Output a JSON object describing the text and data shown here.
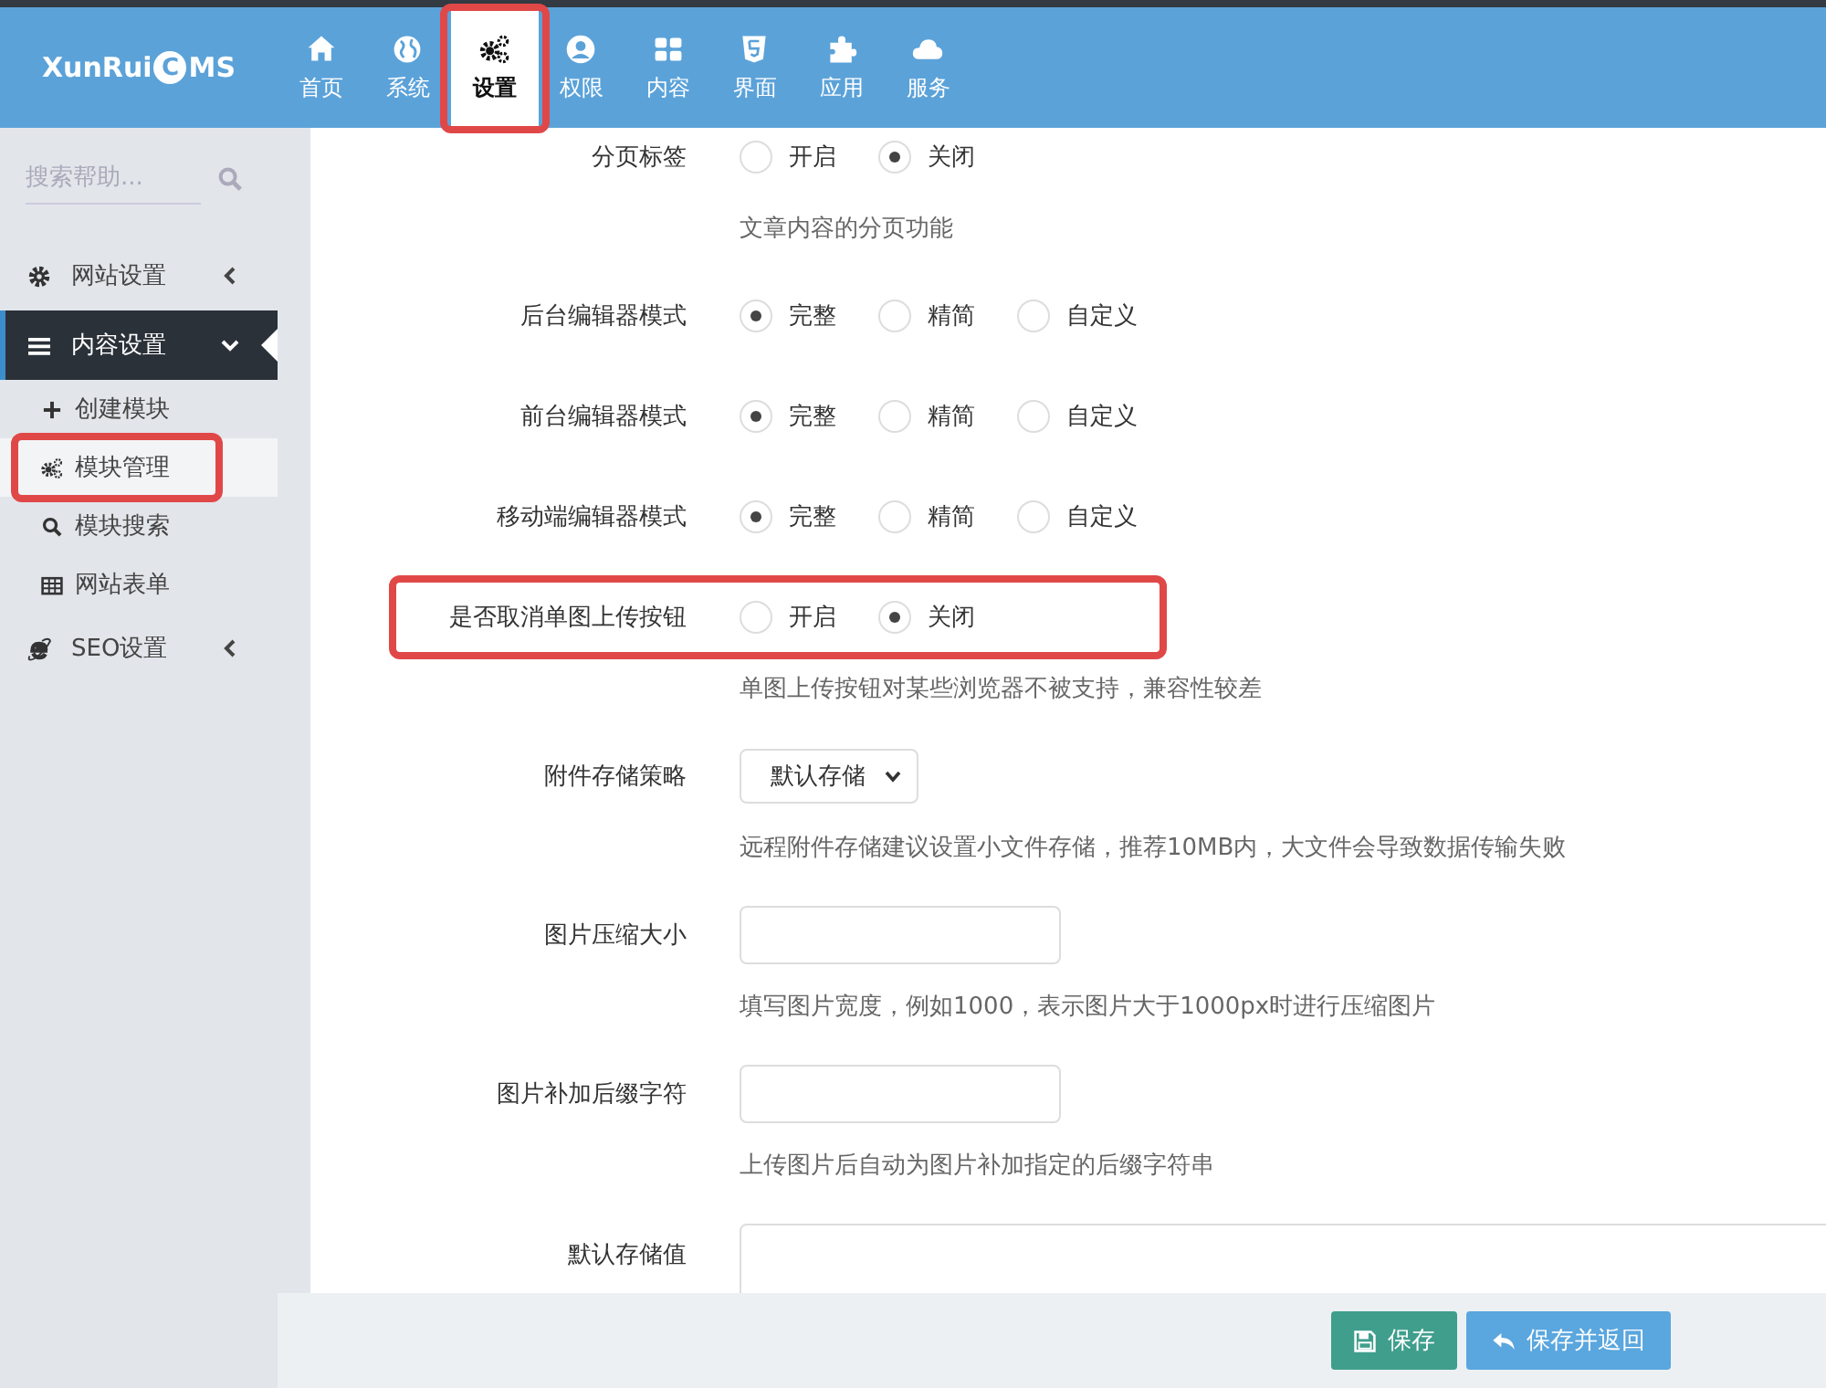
{
  "logo": {
    "prefix": "XunRui",
    "mark": "C",
    "suffix": "MS"
  },
  "nav": [
    {
      "label": "首页",
      "selected": false,
      "highlighted": false
    },
    {
      "label": "系统",
      "selected": false,
      "highlighted": false
    },
    {
      "label": "设置",
      "selected": true,
      "highlighted": true
    },
    {
      "label": "权限",
      "selected": false,
      "highlighted": false
    },
    {
      "label": "内容",
      "selected": false,
      "highlighted": false
    },
    {
      "label": "界面",
      "selected": false,
      "highlighted": false
    },
    {
      "label": "应用",
      "selected": false,
      "highlighted": false
    },
    {
      "label": "服务",
      "selected": false,
      "highlighted": false
    }
  ],
  "sidebar": {
    "search": {
      "placeholder": "搜索帮助..."
    },
    "items": [
      {
        "label": "网站设置",
        "expanded": false,
        "selected": false
      },
      {
        "label": "内容设置",
        "expanded": true,
        "selected": true,
        "children": [
          {
            "label": "创建模块",
            "selected": false,
            "highlighted": false
          },
          {
            "label": "模块管理",
            "selected": true,
            "highlighted": true
          },
          {
            "label": "模块搜索",
            "selected": false,
            "highlighted": false
          },
          {
            "label": "网站表单",
            "selected": false,
            "highlighted": false
          }
        ]
      },
      {
        "label": "SEO设置",
        "expanded": false,
        "selected": false
      }
    ]
  },
  "form": [
    {
      "kind": "radio",
      "label": "分页标签",
      "highlighted": false,
      "options": [
        {
          "label": "开启",
          "selected": false
        },
        {
          "label": "关闭",
          "selected": true
        }
      ],
      "help": "文章内容的分页功能"
    },
    {
      "kind": "radio",
      "label": "后台编辑器模式",
      "highlighted": false,
      "options": [
        {
          "label": "完整",
          "selected": true
        },
        {
          "label": "精简",
          "selected": false
        },
        {
          "label": "自定义",
          "selected": false
        }
      ]
    },
    {
      "kind": "radio",
      "label": "前台编辑器模式",
      "highlighted": false,
      "options": [
        {
          "label": "完整",
          "selected": true
        },
        {
          "label": "精简",
          "selected": false
        },
        {
          "label": "自定义",
          "selected": false
        }
      ]
    },
    {
      "kind": "radio",
      "label": "移动端编辑器模式",
      "highlighted": false,
      "options": [
        {
          "label": "完整",
          "selected": true
        },
        {
          "label": "精简",
          "selected": false
        },
        {
          "label": "自定义",
          "selected": false
        }
      ]
    },
    {
      "kind": "radio",
      "label": "是否取消单图上传按钮",
      "highlighted": true,
      "options": [
        {
          "label": "开启",
          "selected": false
        },
        {
          "label": "关闭",
          "selected": true
        }
      ],
      "help": "单图上传按钮对某些浏览器不被支持，兼容性较差"
    },
    {
      "kind": "select",
      "label": "附件存储策略",
      "highlighted": false,
      "value": "默认存储",
      "help": "远程附件存储建议设置小文件存储，推荐10MB内，大文件会导致数据传输失败"
    },
    {
      "kind": "input",
      "label": "图片压缩大小",
      "highlighted": false,
      "help": "填写图片宽度，例如1000，表示图片大于1000px时进行压缩图片"
    },
    {
      "kind": "input",
      "label": "图片补加后缀字符",
      "highlighted": false,
      "help": "上传图片后自动为图片补加指定的后缀字符串"
    },
    {
      "kind": "textarea",
      "label": "默认存储值",
      "highlighted": false
    }
  ],
  "buttons": [
    {
      "label": "保存",
      "kind": "save"
    },
    {
      "label": "保存并返回",
      "kind": "back"
    }
  ]
}
